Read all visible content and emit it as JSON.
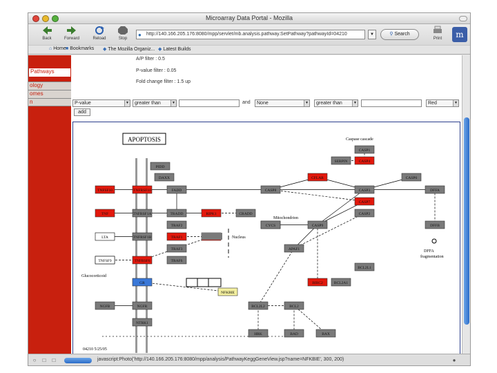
{
  "window": {
    "title": "Microarray Data Portal - Mozilla"
  },
  "toolbar": {
    "buttons": [
      {
        "label": "Back",
        "icon": "back-arrow-icon"
      },
      {
        "label": "Forward",
        "icon": "forward-arrow-icon"
      },
      {
        "label": "Reload",
        "icon": "reload-icon"
      },
      {
        "label": "Stop",
        "icon": "stop-icon"
      }
    ],
    "url": "http://140.166.205.176:8080/mpp/servlet/mb.analysis.pathway.SetPathway?pathwayId=04210",
    "search_label": "Search",
    "print_label": "Print"
  },
  "bookmarks": [
    {
      "label": "Home"
    },
    {
      "label": "Bookmarks"
    },
    {
      "label": "The Mozilla Organiz..."
    },
    {
      "label": "Latest Builds"
    }
  ],
  "sidebar": {
    "items": [
      "Pathways",
      "ology",
      "omes",
      "n"
    ]
  },
  "filters": {
    "line1": "A/P filter : 0.5",
    "line2": "P-value filter : 0.05",
    "line3": "Fold change filter : 1.5 up",
    "select1": "P-value",
    "select2": "greater than",
    "and_label": "and",
    "select3": "None",
    "select4": "greater than",
    "select5": "Red",
    "add_label": "add"
  },
  "diagram": {
    "title": "APOPTOSIS",
    "caspase_label": "Caspase cascade",
    "mito_label": "Mitochondrion",
    "nucleus_label": "Nucleus",
    "dffa_label": "DFFA",
    "dffa_sub": "fragmentation",
    "footer": "04210 5/25/05",
    "gluco_label": "Glucocorticoid",
    "colors": {
      "gray": "#7a7a7a",
      "red": "#e2180c",
      "blue": "#3a78d8",
      "yellow": "#f4f0a0"
    },
    "nodes": [
      {
        "id": "tnfsf10",
        "label": "TNFSF10",
        "color": "red"
      },
      {
        "id": "tnfrsf10",
        "label": "TNFRSF10",
        "color": "red"
      },
      {
        "id": "tnf",
        "label": "TNF",
        "color": "red"
      },
      {
        "id": "tnfrsf1a",
        "label": "TNFRSF1A",
        "color": "gray"
      },
      {
        "id": "lta",
        "label": "LTA",
        "color": "white"
      },
      {
        "id": "tnfrsf1b",
        "label": "TNFRSF1B",
        "color": "gray"
      },
      {
        "id": "tnfsf6",
        "label": "TNFSF6",
        "color": "white"
      },
      {
        "id": "tnfrsf6",
        "label": "TNFRSF6",
        "color": "red"
      },
      {
        "id": "ngfb",
        "label": "NGFB",
        "color": "gray"
      },
      {
        "id": "ngfr",
        "label": "NGFR",
        "color": "gray"
      },
      {
        "id": "ntrk1",
        "label": "NTRK1",
        "color": "gray"
      },
      {
        "id": "gr",
        "label": "GR",
        "color": "blue"
      },
      {
        "id": "pidd",
        "label": "PIDD",
        "color": "gray"
      },
      {
        "id": "daxx",
        "label": "DAXX",
        "color": "gray"
      },
      {
        "id": "fadd",
        "label": "FADD",
        "color": "gray"
      },
      {
        "id": "tradd",
        "label": "TRADD",
        "color": "gray"
      },
      {
        "id": "rip",
        "label": "RIPK1",
        "color": "red"
      },
      {
        "id": "traf2",
        "label": "TRAF2",
        "color": "gray"
      },
      {
        "id": "traf1",
        "label": "TRAF1",
        "color": "red"
      },
      {
        "id": "traf3",
        "label": "TRAF3",
        "color": "gray"
      },
      {
        "id": "traf6",
        "label": "TRAF6",
        "color": "gray"
      },
      {
        "id": "cradd",
        "label": "CRADD",
        "color": "gray"
      },
      {
        "id": "casp8",
        "label": "CASP8",
        "color": "gray"
      },
      {
        "id": "cflar",
        "label": "CFLAR",
        "color": "red"
      },
      {
        "id": "casp10",
        "label": "CASP10",
        "color": "gray"
      },
      {
        "id": "cycs",
        "label": "CYCS",
        "color": "gray"
      },
      {
        "id": "casp9",
        "label": "CASP9",
        "color": "gray"
      },
      {
        "id": "apaf1",
        "label": "APAF1",
        "color": "gray"
      },
      {
        "id": "bcl2l1",
        "label": "BCL2L1",
        "color": "gray"
      },
      {
        "id": "birc",
        "label": "BIRC2",
        "color": "red"
      },
      {
        "id": "bcl2a1",
        "label": "BCL2A1",
        "color": "gray"
      },
      {
        "id": "bcl2l2",
        "label": "BCL2L2",
        "color": "gray"
      },
      {
        "id": "bcl2",
        "label": "BCL2",
        "color": "gray"
      },
      {
        "id": "hrk",
        "label": "HRK",
        "color": "gray"
      },
      {
        "id": "bad",
        "label": "BAD",
        "color": "gray"
      },
      {
        "id": "bax",
        "label": "BAX",
        "color": "gray"
      },
      {
        "id": "nfkb",
        "label": "NFKBIE",
        "color": "yellow"
      },
      {
        "id": "casp1",
        "label": "CASP1",
        "color": "gray"
      },
      {
        "id": "serpin",
        "label": "SERPIN",
        "color": "gray"
      },
      {
        "id": "casp4",
        "label": "CASP4",
        "color": "red"
      },
      {
        "id": "casp3",
        "label": "CASP3",
        "color": "gray"
      },
      {
        "id": "casp6",
        "label": "CASP6",
        "color": "gray"
      },
      {
        "id": "casp7",
        "label": "CASP7",
        "color": "red"
      },
      {
        "id": "casp2",
        "label": "CASP2",
        "color": "gray"
      },
      {
        "id": "dffa",
        "label": "DFFA",
        "color": "gray"
      },
      {
        "id": "dffb",
        "label": "DFFB",
        "color": "gray"
      },
      {
        "id": "iap",
        "label": "IAP",
        "color": "red"
      },
      {
        "id": "tnfsf9",
        "label": "TNFSF9",
        "color": "white"
      }
    ]
  },
  "status": {
    "text": "javascript:Photo('http://140.166.205.176:8080/mpp/analysis/PathwayKeggGeneView.jsp?name=NFKBIE', 300, 200)"
  }
}
